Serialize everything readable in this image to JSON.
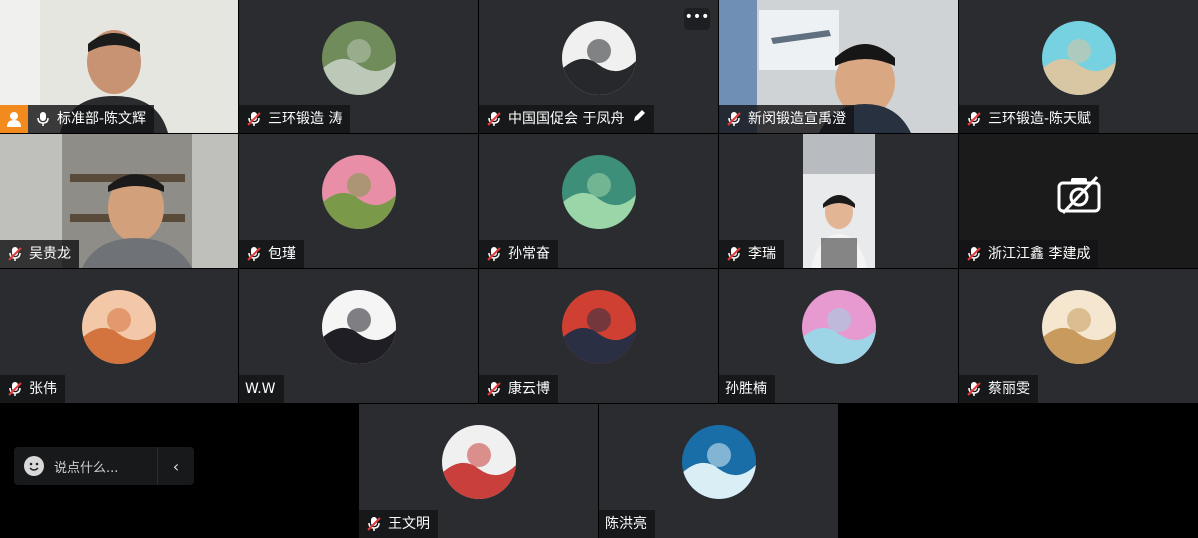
{
  "participants": [
    {
      "id": "p1",
      "name": "标准部-陈文辉",
      "muted": false,
      "host": true,
      "type": "video"
    },
    {
      "id": "p2",
      "name": "三环锻造 涛",
      "muted": true,
      "type": "avatar",
      "colors": [
        "#6f8c5a",
        "#bcc9b8"
      ]
    },
    {
      "id": "p3",
      "name": "中国国促会 于凤舟",
      "muted": true,
      "type": "avatar",
      "editable": true,
      "more": "•••",
      "colors": [
        "#f0f0f0",
        "#26282c"
      ]
    },
    {
      "id": "p4",
      "name": "新闵锻造宣禹澄",
      "muted": true,
      "type": "video"
    },
    {
      "id": "p5",
      "name": "三环锻造-陈天赋",
      "muted": true,
      "type": "avatar",
      "colors": [
        "#76d1e0",
        "#d9c6a2"
      ]
    },
    {
      "id": "p6",
      "name": "吴贵龙",
      "muted": true,
      "type": "video"
    },
    {
      "id": "p7",
      "name": "包瑾",
      "muted": true,
      "type": "avatar",
      "colors": [
        "#e88fa7",
        "#7a9a4a"
      ]
    },
    {
      "id": "p8",
      "name": "孙常奋",
      "muted": true,
      "type": "avatar",
      "colors": [
        "#3e8f7a",
        "#9bd6a8"
      ]
    },
    {
      "id": "p9",
      "name": "李瑞",
      "muted": true,
      "type": "video"
    },
    {
      "id": "p10",
      "name": "浙江江鑫 李建成",
      "muted": true,
      "type": "camera-off"
    },
    {
      "id": "p11",
      "name": "张伟",
      "muted": true,
      "type": "avatar",
      "colors": [
        "#f3c8a8",
        "#d3733e"
      ]
    },
    {
      "id": "p12",
      "name": "W.W",
      "muted": false,
      "type": "avatar",
      "colors": [
        "#f5f5f5",
        "#1e1e24"
      ]
    },
    {
      "id": "p13",
      "name": "康云博",
      "muted": true,
      "type": "avatar",
      "colors": [
        "#cf4033",
        "#2a2f44"
      ]
    },
    {
      "id": "p14",
      "name": "孙胜楠",
      "muted": false,
      "type": "avatar",
      "colors": [
        "#e69ad0",
        "#9ed5e6"
      ]
    },
    {
      "id": "p15",
      "name": "蔡丽雯",
      "muted": true,
      "type": "avatar",
      "colors": [
        "#f4e6cf",
        "#c99a5e"
      ]
    },
    {
      "id": "p16",
      "name": "王文明",
      "muted": true,
      "type": "avatar",
      "colors": [
        "#f0f0f0",
        "#c93f3b"
      ]
    },
    {
      "id": "p17",
      "name": "陈洪亮",
      "muted": false,
      "type": "avatar",
      "colors": [
        "#1a6ea8",
        "#d9eef5"
      ]
    }
  ],
  "chat": {
    "placeholder": "说点什么...",
    "collapse_icon": "chevron-left-icon",
    "emoji_icon": "smile-icon"
  },
  "colors": {
    "tile_bg": "#2b2c30",
    "label_bg": "#141416",
    "host_badge": "#f28a1e",
    "mic_muted": "#e23b3b"
  }
}
